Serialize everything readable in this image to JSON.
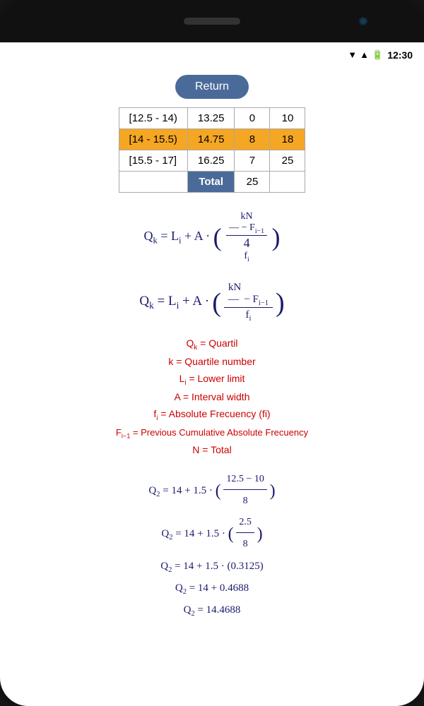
{
  "phone": {
    "time": "12:30"
  },
  "ui": {
    "return_button": "Return",
    "table": {
      "rows": [
        {
          "interval": "[12.5 - 14)",
          "midpoint": "13.25",
          "freq": "0",
          "cumfreq": "10",
          "highlighted": false
        },
        {
          "interval": "[14 - 15.5)",
          "midpoint": "14.75",
          "freq": "8",
          "cumfreq": "18",
          "highlighted": true
        },
        {
          "interval": "[15.5 - 17]",
          "midpoint": "16.25",
          "freq": "7",
          "cumfreq": "25",
          "highlighted": false
        }
      ],
      "total_label": "Total",
      "total_value": "25"
    },
    "formula": {
      "text": "Qk = Li + A · ( kN/4 − Fi−1 ) / fi"
    },
    "definitions": [
      {
        "text": "Qk = Quartil"
      },
      {
        "text": "k = Quartile number"
      },
      {
        "text": "Li = Lower limit"
      },
      {
        "text": "A = Interval width"
      },
      {
        "text": "fi = Absolute Frecuency (fi)"
      },
      {
        "text": "Fi−1 = Previous Cumulative Absolute Frecuency"
      },
      {
        "text": "N = Total"
      }
    ],
    "calculations": [
      {
        "text": "Q₂ = 14 + 1.5 · ( (12.5 − 10) / 8 )"
      },
      {
        "text": "Q₂ = 14 + 1.5 · ( 2.5 / 8 )"
      },
      {
        "text": "Q₂ = 14 + 1.5 · (0.3125)"
      },
      {
        "text": "Q₂ = 14 + 0.4688"
      },
      {
        "text": "Q₂ = 14.4688"
      }
    ]
  }
}
